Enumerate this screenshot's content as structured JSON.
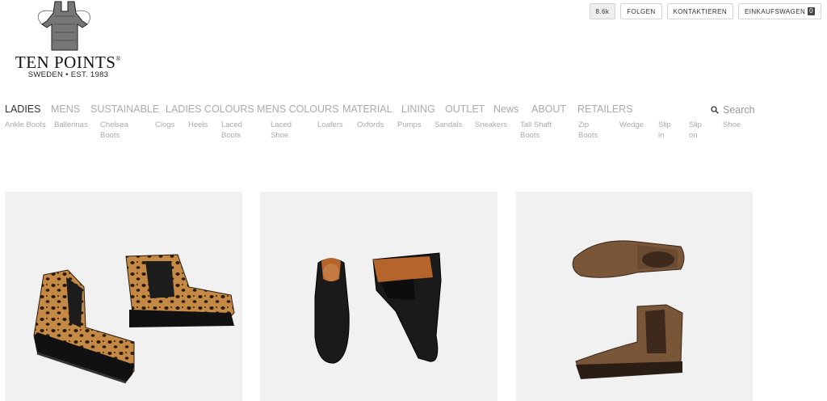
{
  "brand": {
    "name": "TEN POINTS",
    "trademark": "®",
    "tagline": "SWEDEN • EST. 1983"
  },
  "topbar": {
    "count": "8.6k",
    "follow": "FOLGEN",
    "contact": "KONTAKTIEREN",
    "cart": "EINKAUFSWAGEN",
    "cart_count": "0"
  },
  "nav": {
    "items": [
      "LADIES",
      "MENS",
      "SUSTAINABLE",
      "LADIES COLOURS",
      "MENS COLOURS",
      "MATERIAL",
      "LINING",
      "OUTLET",
      "News",
      "ABOUT",
      "RETAILERS"
    ],
    "search_label": "Search"
  },
  "subnav": {
    "items": [
      "Ankle Boots",
      "Ballerinas",
      "Chelsea Boots",
      "Clogs",
      "Heels",
      "Laced Boots",
      "Laced Shoe",
      "Loafers",
      "Oxfords",
      "Pumps",
      "Sandals",
      "Sneakers",
      "Tall Shaft Boots",
      "Zip Boots",
      "Wedge",
      "Slip in",
      "Slip on",
      "Shoe"
    ]
  },
  "products": [
    {
      "name": "leopard-chelsea-boots",
      "color": "#b8823f"
    },
    {
      "name": "black-chelsea-boots",
      "color": "#1a1a1a"
    },
    {
      "name": "brown-suede-chelsea-boots",
      "color": "#6b4a33"
    }
  ]
}
